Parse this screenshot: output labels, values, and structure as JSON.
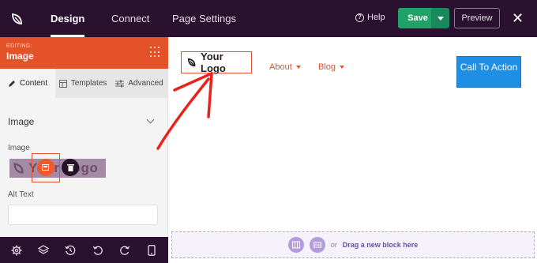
{
  "topbar": {
    "brand_icon": "seedprod-leaf-icon",
    "tabs": [
      {
        "label": "Design",
        "active": true
      },
      {
        "label": "Connect",
        "active": false
      },
      {
        "label": "Page Settings",
        "active": false
      }
    ],
    "help_label": "Help",
    "save_label": "Save",
    "preview_label": "Preview",
    "close_label": "✕"
  },
  "sidebar": {
    "editing_label": "EDITING:",
    "editing_title": "Image",
    "subtabs": [
      {
        "label": "Content",
        "icon": "pencil-icon",
        "active": true
      },
      {
        "label": "Templates",
        "icon": "templates-icon",
        "active": false
      },
      {
        "label": "Advanced",
        "icon": "sliders-icon",
        "active": false
      }
    ],
    "section_title": "Image",
    "image_label": "Image",
    "image_preview_text": "Your Logo",
    "alt_text_label": "Alt Text",
    "alt_text_value": "",
    "bottom_icons": [
      "gear-icon",
      "layers-icon",
      "history-icon",
      "undo-icon",
      "redo-icon",
      "mobile-icon"
    ]
  },
  "canvas": {
    "logo_text": "Your Logo",
    "nav": [
      {
        "label": "About"
      },
      {
        "label": "Blog"
      }
    ],
    "cta_label": "Call To Action",
    "dropzone_or": "or",
    "dropzone_text": "Drag a new block here"
  },
  "colors": {
    "topbar_bg": "#2a1130",
    "accent_orange": "#e35228",
    "save_green": "#20a266",
    "cta_blue": "#1f8fe5",
    "dropzone_purple": "#b39bdc",
    "annotation_red": "#e8231c"
  }
}
